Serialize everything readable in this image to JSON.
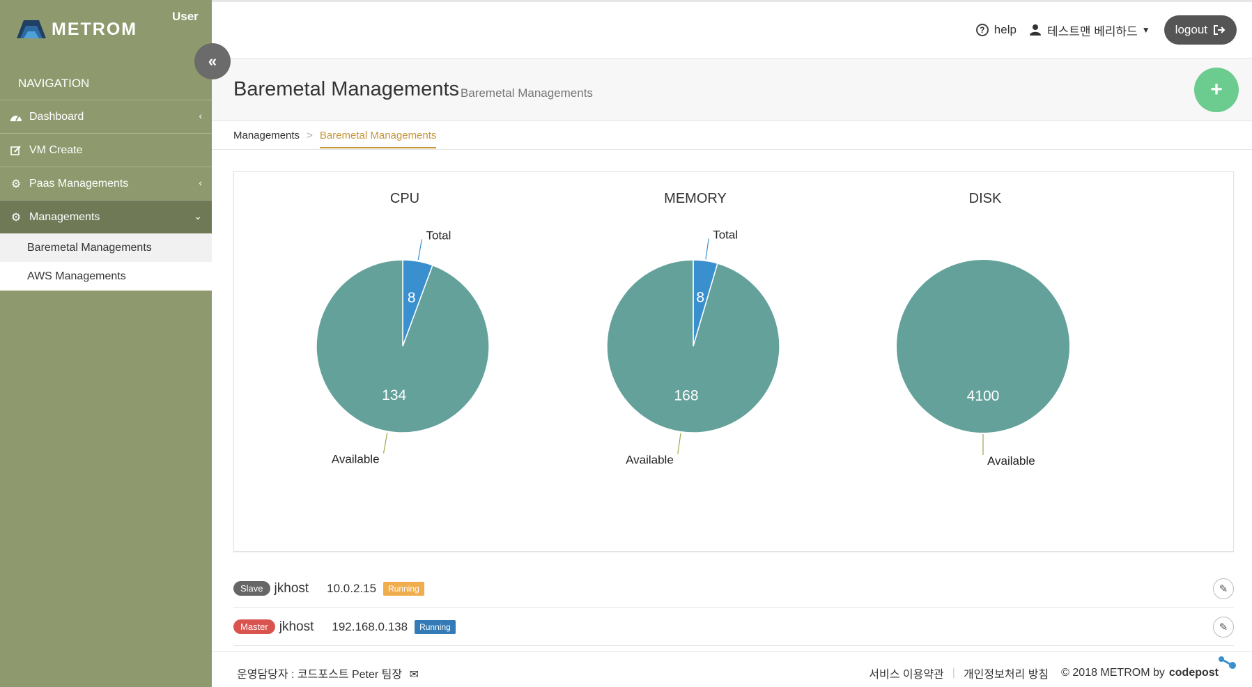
{
  "app": {
    "brand": "METROM",
    "user_label": "User",
    "collapse_icon": "«"
  },
  "sidebar": {
    "nav_title": "NAVIGATION",
    "items": [
      {
        "label": "Dashboard",
        "icon": "dashboard-icon",
        "has_children": true
      },
      {
        "label": "VM Create",
        "icon": "edit-icon",
        "has_children": false
      },
      {
        "label": "Paas Managements",
        "icon": "gear-icon",
        "has_children": true
      },
      {
        "label": "Managements",
        "icon": "gear-icon",
        "has_children": true,
        "expanded": true
      }
    ],
    "sub_items": [
      {
        "label": "Baremetal Managements",
        "current": true
      },
      {
        "label": "AWS Managements",
        "current": false
      }
    ]
  },
  "header": {
    "help": "help",
    "user_name": "테스트맨 베리하드",
    "logout": "logout"
  },
  "page": {
    "title": "Baremetal Managements",
    "subtitle": "Baremetal Managements",
    "add_button": "+"
  },
  "breadcrumb": {
    "parent": "Managements",
    "separator": ">",
    "current": "Baremetal Managements"
  },
  "colors": {
    "sidebar": "#8e9a6d",
    "available": "#63a19a",
    "total": "#3a8fcf",
    "accent": "#c5963a",
    "fab": "#6ccb8e"
  },
  "chart_data": [
    {
      "type": "pie",
      "title": "CPU",
      "slices": [
        {
          "label": "Total",
          "value": 8
        },
        {
          "label": "Available",
          "value": 134
        }
      ]
    },
    {
      "type": "pie",
      "title": "MEMORY",
      "slices": [
        {
          "label": "Total",
          "value": 8
        },
        {
          "label": "Available",
          "value": 168
        }
      ]
    },
    {
      "type": "pie",
      "title": "DISK",
      "slices": [
        {
          "label": "Available",
          "value": 4100
        }
      ]
    }
  ],
  "hosts": [
    {
      "role": "Slave",
      "name": "jkhost",
      "ip": "10.0.2.15",
      "status": "Running"
    },
    {
      "role": "Master",
      "name": "jkhost",
      "ip": "192.168.0.138",
      "status": "Running"
    }
  ],
  "footer": {
    "manager": "운영담당자 : 코드포스트 Peter 팀장",
    "terms": "서비스 이용약관",
    "privacy": "개인정보처리 방침",
    "copyright": "© 2018 METROM by",
    "brand_tag": "codepost"
  }
}
